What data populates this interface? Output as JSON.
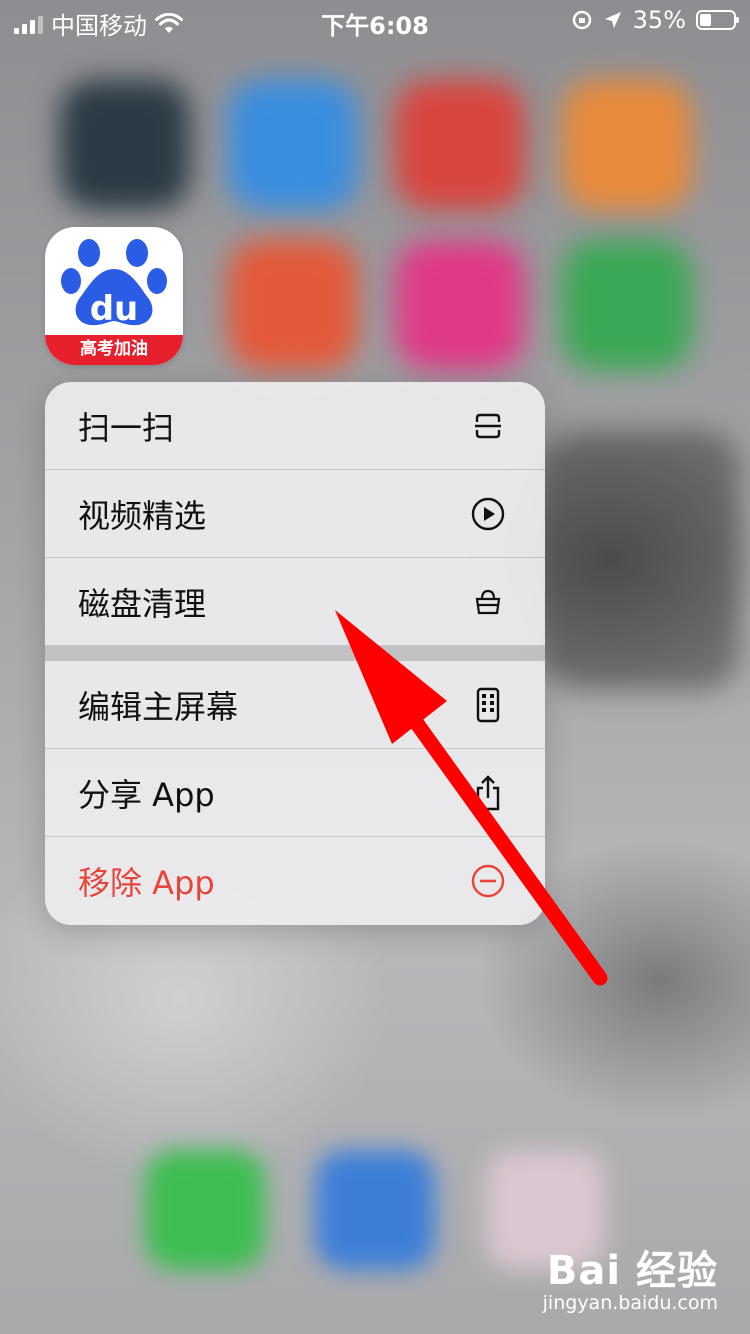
{
  "status_bar": {
    "carrier": "中国移动",
    "time": "下午6:08",
    "battery_percent": "35%",
    "battery_level": 0.35
  },
  "app": {
    "icon_name": "baidu-paw-icon",
    "logo_text": "du",
    "banner_text": "高考加油"
  },
  "menu": {
    "items": [
      {
        "label": "扫一扫",
        "icon": "scan-icon"
      },
      {
        "label": "视频精选",
        "icon": "play-circle-icon"
      },
      {
        "label": "磁盘清理",
        "icon": "basket-icon"
      }
    ],
    "system_items": [
      {
        "label": "编辑主屏幕",
        "icon": "phone-screen-icon"
      },
      {
        "label": "分享 App",
        "icon": "share-icon"
      },
      {
        "label": "移除 App",
        "icon": "minus-circle-icon"
      }
    ]
  },
  "colors": {
    "destructive": "#e8443a",
    "arrow": "#ff0000",
    "baidu_blue": "#2b5ce6",
    "banner_red": "#e8202d"
  },
  "watermark": {
    "logo": "Bai 经验",
    "url": "jingyan.baidu.com"
  }
}
